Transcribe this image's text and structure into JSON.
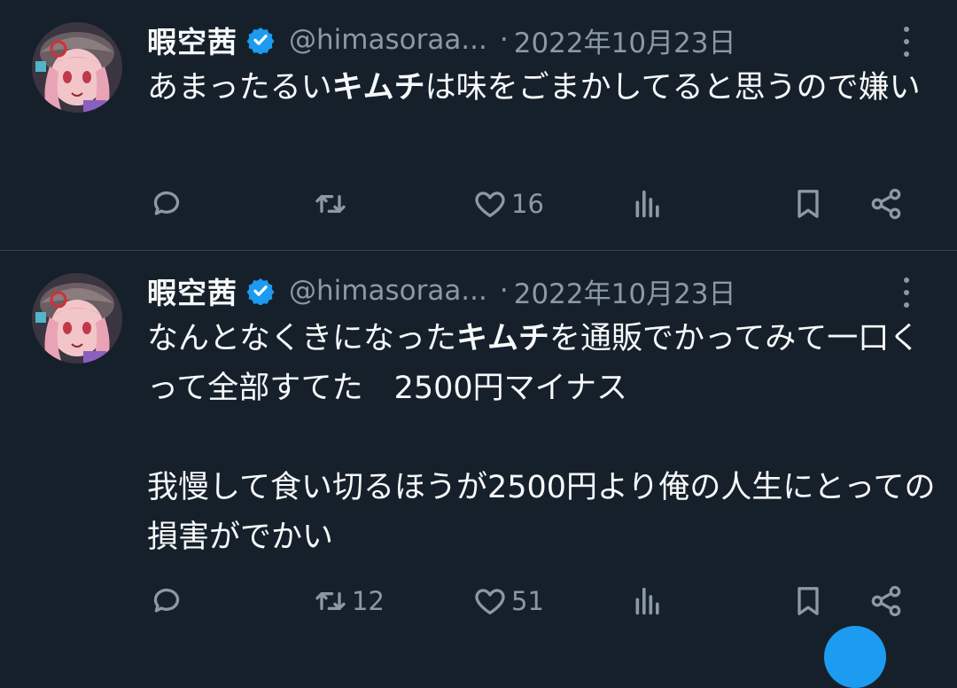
{
  "tweets": [
    {
      "author_name": "暇空茜",
      "handle": "@himasoraa...",
      "separator": "·",
      "date": "2022年10月23日",
      "text_parts": [
        {
          "t": "あまったるい",
          "bold": false
        },
        {
          "t": "キムチ",
          "bold": true
        },
        {
          "t": "は味をごまかしてると思うので嫌い",
          "bold": false
        }
      ],
      "replies": "",
      "retweets": "",
      "likes": "16"
    },
    {
      "author_name": "暇空茜",
      "handle": "@himasoraa...",
      "separator": "·",
      "date": "2022年10月23日",
      "text_parts": [
        {
          "t": "なんとなくきになった",
          "bold": false
        },
        {
          "t": "キムチ",
          "bold": true
        },
        {
          "t": "を通販でかってみて一口くって全部すてた　2500円マイナス",
          "bold": false
        }
      ],
      "text_para2": "我慢して食い切るほうが2500円より俺の人生にとっての損害がでかい",
      "replies": "",
      "retweets": "12",
      "likes": "51"
    }
  ],
  "icons": {
    "verified": "verified-badge-icon",
    "reply": "reply-icon",
    "retweet": "retweet-icon",
    "like": "heart-icon",
    "views": "views-chart-icon",
    "bookmark": "bookmark-icon",
    "share": "share-icon",
    "more": "more-vertical-icon"
  },
  "colors": {
    "background": "#15202b",
    "text": "#f7f9f9",
    "secondary": "#8b98a5",
    "verified": "#1d9bf0",
    "divider": "#38444d"
  }
}
